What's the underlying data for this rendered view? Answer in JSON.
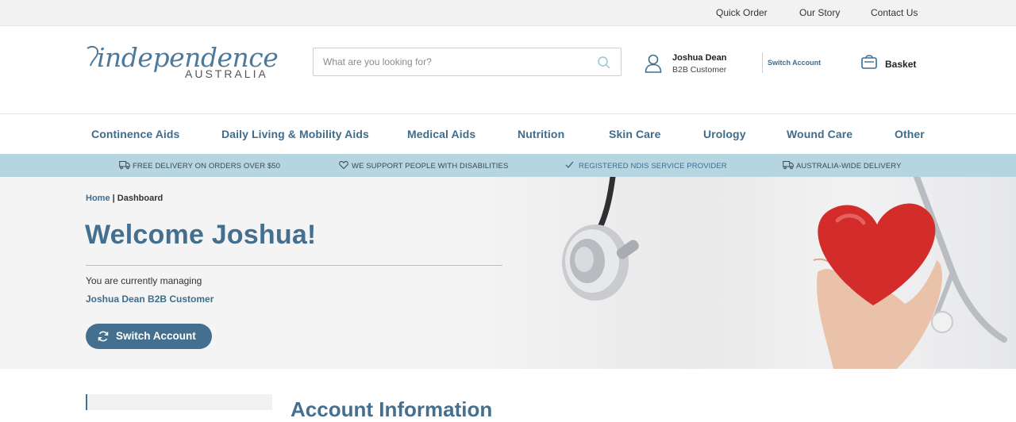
{
  "utility_nav": {
    "quick_order": "Quick Order",
    "our_story": "Our Story",
    "contact_us": "Contact Us"
  },
  "header": {
    "logo": {
      "word": "independence",
      "sub": "AUSTRALIA"
    },
    "search": {
      "placeholder": "What are you looking for?",
      "value": ""
    },
    "account": {
      "name": "Joshua Dean",
      "type": "B2B Customer"
    },
    "switch_account_label": "Switch Account",
    "basket_label": "Basket"
  },
  "main_nav": [
    {
      "label": "Continence Aids"
    },
    {
      "label": "Daily Living & Mobility Aids"
    },
    {
      "label": "Medical Aids"
    },
    {
      "label": "Nutrition"
    },
    {
      "label": "Skin Care"
    },
    {
      "label": "Urology"
    },
    {
      "label": "Wound Care"
    },
    {
      "label": "Other"
    }
  ],
  "usp_bar": [
    {
      "icon": "truck-icon",
      "text": "FREE DELIVERY ON ORDERS OVER $50"
    },
    {
      "icon": "heart-icon",
      "text": "WE SUPPORT PEOPLE WITH DISABILITIES"
    },
    {
      "icon": "check-icon",
      "text": "REGISTERED NDIS SERVICE PROVIDER"
    },
    {
      "icon": "truck-icon",
      "text": "AUSTRALIA-WIDE DELIVERY"
    }
  ],
  "hero": {
    "breadcrumb": {
      "home": "Home",
      "separator": "|",
      "current": "Dashboard"
    },
    "title": "Welcome Joshua!",
    "managing_text": "You are currently managing",
    "managed_account": "Joshua Dean B2B Customer",
    "switch_button": "Switch Account",
    "image_subject": "stethoscope and red heart held in hand"
  },
  "content": {
    "section_title": "Account Information"
  },
  "colors": {
    "brand_blue": "#446f8f",
    "link_blue": "#3d6e8f",
    "usp_bg": "#b5d5e0",
    "heart_red": "#d42b2b"
  }
}
